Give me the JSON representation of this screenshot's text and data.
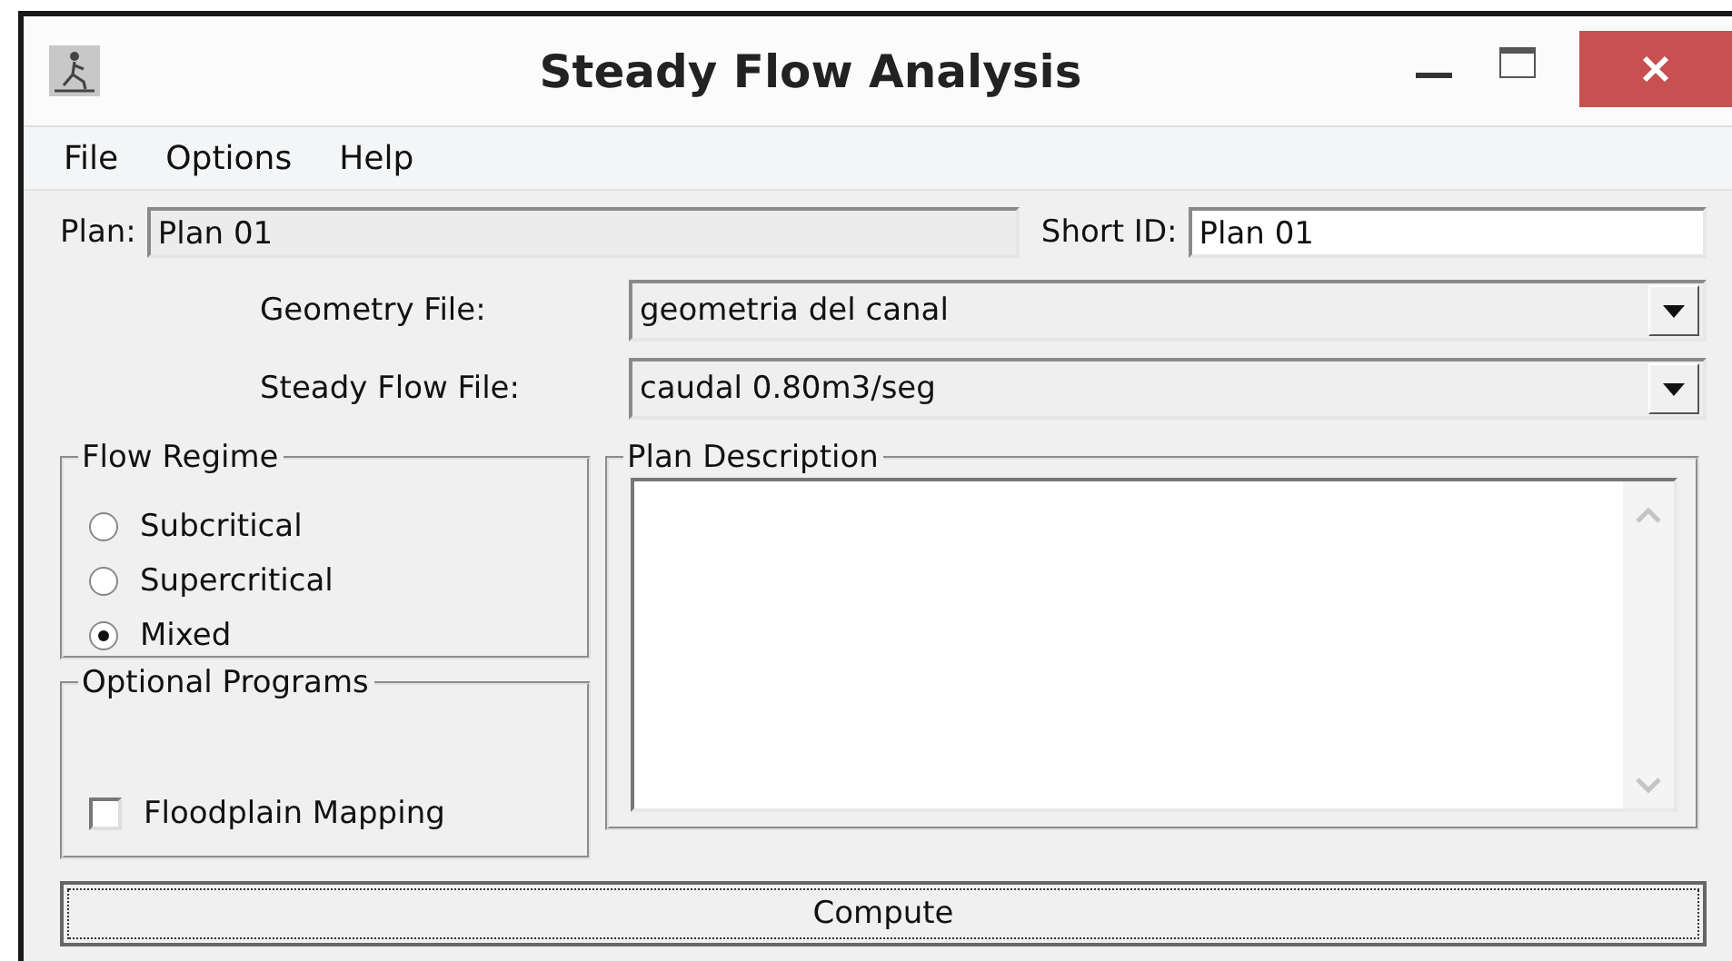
{
  "window": {
    "title": "Steady Flow Analysis"
  },
  "menu": [
    "File",
    "Options",
    "Help"
  ],
  "plan": {
    "label": "Plan:",
    "value": "Plan 01"
  },
  "short_id": {
    "label": "Short ID:",
    "value": "Plan 01"
  },
  "files": [
    {
      "label": "Geometry File:",
      "value": "geometria del canal"
    },
    {
      "label": "Steady Flow File:",
      "value": "caudal 0.80m3/seg"
    }
  ],
  "flow_regime": {
    "title": "Flow Regime",
    "options": [
      {
        "label": "Subcritical",
        "selected": false
      },
      {
        "label": "Supercritical",
        "selected": false
      },
      {
        "label": "Mixed",
        "selected": true
      }
    ]
  },
  "optional_programs": {
    "title": "Optional Programs",
    "items": [
      {
        "label": "Floodplain Mapping",
        "checked": false
      }
    ]
  },
  "plan_description": {
    "title": "Plan Description"
  },
  "buttons": [
    "Compute"
  ]
}
